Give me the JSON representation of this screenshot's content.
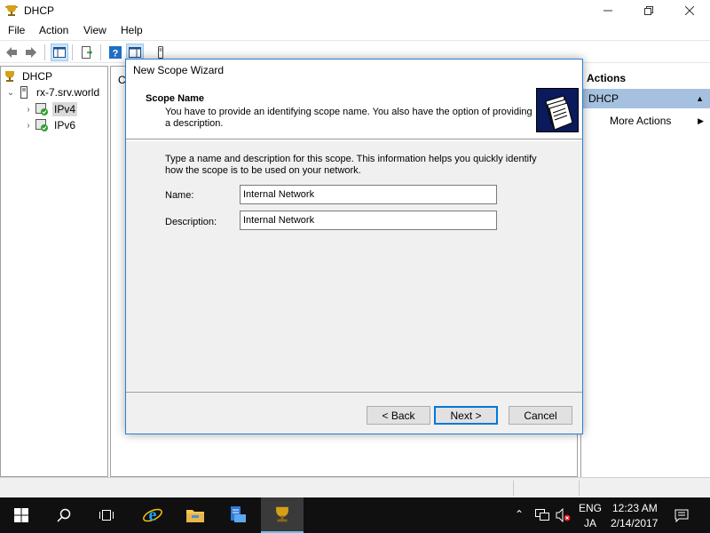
{
  "window": {
    "title": "DHCP",
    "icon": "dhcp-trophy-icon"
  },
  "menu": {
    "items": [
      "File",
      "Action",
      "View",
      "Help"
    ]
  },
  "toolbar": {
    "buttons": [
      "back-arrow-icon",
      "forward-arrow-icon",
      "show-hide-console-tree-icon",
      "export-list-icon",
      "help-icon",
      "action-pane-icon",
      "server-icon"
    ]
  },
  "tree": {
    "root": "DHCP",
    "server": "rx-7.srv.world",
    "ipv4": "IPv4",
    "ipv6": "IPv6"
  },
  "center": {
    "column_partial": "C"
  },
  "actions": {
    "header": "Actions",
    "section": "DHCP",
    "more_actions": "More Actions"
  },
  "wizard": {
    "title": "New Scope Wizard",
    "heading": "Scope Name",
    "subheading": "You have to provide an identifying scope name. You also have the option of providing a description.",
    "intro": "Type a name and description for this scope. This information helps you quickly identify how the scope is to be used on your network.",
    "name_label": "Name:",
    "name_value": "Internal Network",
    "description_label": "Description:",
    "description_value": "Internal Network",
    "back_label": "< Back",
    "next_label": "Next >",
    "cancel_label": "Cancel"
  },
  "taskbar": {
    "items": [
      "windows-start-icon",
      "search-icon",
      "task-view-icon",
      "internet-explorer-icon",
      "file-explorer-icon",
      "server-manager-icon",
      "dhcp-trophy-icon"
    ],
    "active": "dhcp-trophy-icon"
  },
  "tray": {
    "language": "ENG",
    "input_method": "JA",
    "time": "12:23 AM",
    "date": "2/14/2017"
  },
  "colors": {
    "accent": "#0078d7",
    "actions_section_bg": "#a6c1e0",
    "taskbar_bg": "#101010"
  }
}
